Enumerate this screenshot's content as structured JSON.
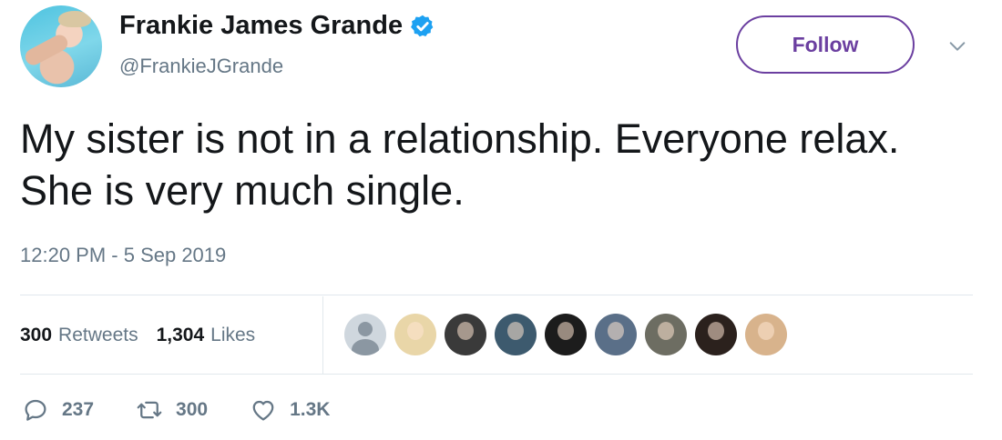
{
  "user": {
    "display_name": "Frankie James Grande",
    "handle": "@FrankieJGrande",
    "verified": true,
    "avatar_icon": "user-avatar-photo"
  },
  "follow_label": "Follow",
  "tweet": {
    "text": "My sister is not in a relationship. Everyone relax. She is very much single.",
    "timestamp": "12:20 PM - 5 Sep 2019"
  },
  "stats": {
    "retweets_count": "300",
    "retweets_label": "Retweets",
    "likes_count": "1,304",
    "likes_label": "Likes"
  },
  "likers": [
    {
      "color": "#cfd7de",
      "kind": "default-avatar"
    },
    {
      "color": "#e9d6a8"
    },
    {
      "color": "#3a3a3a"
    },
    {
      "color": "#3d5a6e"
    },
    {
      "color": "#1c1c1c"
    },
    {
      "color": "#5a6f88"
    },
    {
      "color": "#6d6d62"
    },
    {
      "color": "#2b211d"
    },
    {
      "color": "#d8b38c"
    }
  ],
  "actions": {
    "reply_count": "237",
    "retweet_count": "300",
    "like_count": "1.3K"
  },
  "colors": {
    "accent": "#6b3fa0",
    "verified": "#1da1f2",
    "secondary_text": "#657786"
  }
}
